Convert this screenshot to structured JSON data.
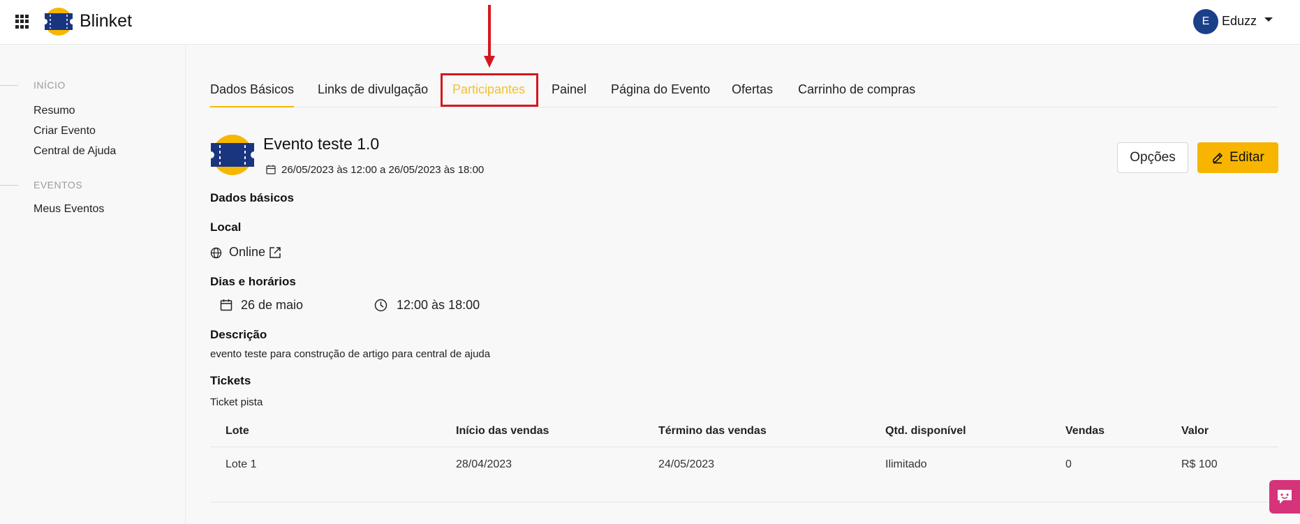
{
  "header": {
    "brand": "Blinket",
    "user": {
      "initial": "E",
      "name": "Eduzz"
    }
  },
  "sidebar": {
    "sections": [
      {
        "title": "INÍCIO",
        "items": [
          "Resumo",
          "Criar Evento",
          "Central de Ajuda"
        ]
      },
      {
        "title": "EVENTOS",
        "items": [
          "Meus Eventos"
        ]
      }
    ]
  },
  "tabs": [
    {
      "label": "Dados Básicos",
      "active": true
    },
    {
      "label": "Links de divulgação"
    },
    {
      "label": "Participantes",
      "highlighted": true
    },
    {
      "label": "Painel"
    },
    {
      "label": "Página do Evento"
    },
    {
      "label": "Ofertas"
    },
    {
      "label": "Carrinho de compras"
    }
  ],
  "event": {
    "title": "Evento teste 1.0",
    "dates": "26/05/2023 às 12:00 a 26/05/2023 às 18:00",
    "options_label": "Opções",
    "edit_label": "Editar"
  },
  "details": {
    "basic_title": "Dados básicos",
    "local_title": "Local",
    "local_value": "Online",
    "schedule_title": "Dias e horários",
    "day": "26 de maio",
    "time": "12:00 às 18:00",
    "description_title": "Descrição",
    "description": "evento teste para construção de artigo para central de ajuda",
    "tickets_title": "Tickets",
    "ticket_name": "Ticket pista"
  },
  "table": {
    "headers": [
      "Lote",
      "Início das vendas",
      "Término das vendas",
      "Qtd. disponível",
      "Vendas",
      "Valor"
    ],
    "rows": [
      [
        "Lote 1",
        "28/04/2023",
        "24/05/2023",
        "Ilimitado",
        "0",
        "R$ 100"
      ]
    ]
  },
  "colors": {
    "accent": "#f5b700",
    "annotation": "#d5171e",
    "avatar": "#1c3f8a",
    "chat_widget": "#d5337a"
  },
  "icons": [
    "apps-grid-icon",
    "ticket-logo-icon",
    "chevron-down-icon",
    "calendar-icon",
    "globe-icon",
    "external-link-icon",
    "clock-icon",
    "pencil-icon",
    "chat-icon"
  ]
}
